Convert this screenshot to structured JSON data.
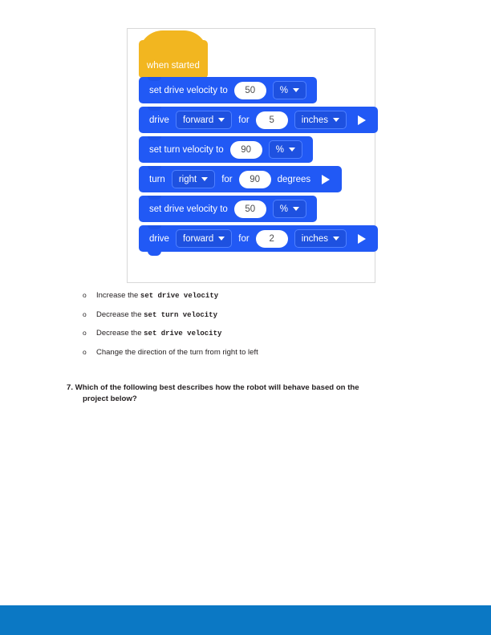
{
  "figure": {
    "name": "vexcode-block-project-screenshot",
    "hat_block": {
      "label": "when started",
      "color": "#f2b620"
    },
    "block_color": "#2159f5",
    "dropdown_color": "#1e51e0",
    "blocks": [
      {
        "id": "set-drive-velocity-1",
        "text_before": "set drive velocity to",
        "value": "50",
        "unit": "%",
        "has_play": false
      },
      {
        "id": "drive-1",
        "text_before": "drive",
        "direction": "forward",
        "text_middle": "for",
        "value": "5",
        "unit": "inches",
        "has_play": true
      },
      {
        "id": "set-turn-velocity-1",
        "text_before": "set turn velocity to",
        "value": "90",
        "unit": "%",
        "has_play": false
      },
      {
        "id": "turn-1",
        "text_before": "turn",
        "direction": "right",
        "text_middle": "for",
        "value": "90",
        "unit_text": "degrees",
        "has_play": true
      },
      {
        "id": "set-drive-velocity-2",
        "text_before": "set drive velocity to",
        "value": "50",
        "unit": "%",
        "has_play": false
      },
      {
        "id": "drive-2",
        "text_before": "drive",
        "direction": "forward",
        "text_middle": "for",
        "value": "2",
        "unit": "inches",
        "has_play": true
      }
    ]
  },
  "options": {
    "bullet": "o",
    "items": [
      {
        "prefix": "Increase the ",
        "code": "set drive velocity",
        "suffix": ""
      },
      {
        "prefix": "Decrease the ",
        "code": "set turn velocity",
        "suffix": ""
      },
      {
        "prefix": "Decrease the ",
        "code": "set drive velocity",
        "suffix": ""
      },
      {
        "prefix": "Change the direction of the turn from right to left",
        "code": "",
        "suffix": ""
      }
    ]
  },
  "question": {
    "line1": "7. Which of the following best describes how the robot will behave based on  the",
    "line2": "project below?"
  },
  "footer": {
    "color": "#0b78c4"
  }
}
